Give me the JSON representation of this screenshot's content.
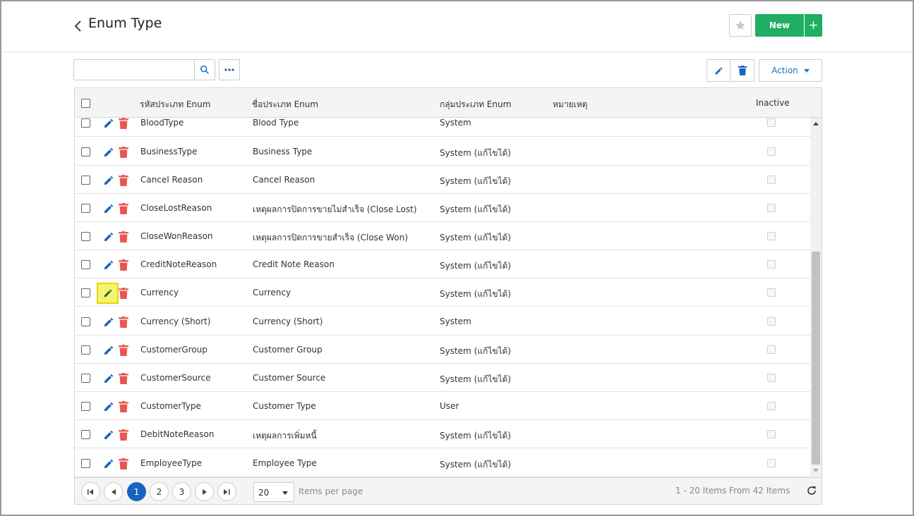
{
  "header": {
    "title": "Enum Type",
    "new_label": "New",
    "plus_label": "+"
  },
  "toolbar": {
    "search_placeholder": "",
    "action_label": "Action"
  },
  "columns": {
    "code": "รหัสประเภท Enum",
    "name": "ชื่อประเภท Enum",
    "group": "กลุ่มประเภท Enum",
    "note": "หมายเหตุ",
    "inactive": "Inactive"
  },
  "rows": [
    {
      "code": "BloodType",
      "name": "Blood Type",
      "group": "System"
    },
    {
      "code": "BusinessType",
      "name": "Business Type",
      "group": "System (แก้ไขได้)"
    },
    {
      "code": "Cancel Reason",
      "name": "Cancel Reason",
      "group": "System (แก้ไขได้)"
    },
    {
      "code": "CloseLostReason",
      "name": "เหตุผลการปิดการขายไม่สำเร็จ (Close Lost)",
      "group": "System (แก้ไขได้)"
    },
    {
      "code": "CloseWonReason",
      "name": "เหตุผลการปิดการขายสำเร็จ (Close Won)",
      "group": "System (แก้ไขได้)"
    },
    {
      "code": "CreditNoteReason",
      "name": "Credit Note Reason",
      "group": "System (แก้ไขได้)"
    },
    {
      "code": "Currency",
      "name": "Currency",
      "group": "System (แก้ไขได้)"
    },
    {
      "code": "Currency (Short)",
      "name": "Currency (Short)",
      "group": "System"
    },
    {
      "code": "CustomerGroup",
      "name": "Customer Group",
      "group": "System (แก้ไขได้)"
    },
    {
      "code": "CustomerSource",
      "name": "Customer Source",
      "group": "System (แก้ไขได้)"
    },
    {
      "code": "CustomerType",
      "name": "Customer Type",
      "group": "User"
    },
    {
      "code": "DebitNoteReason",
      "name": "เหตุผลการเพิ่มหนี้",
      "group": "System (แก้ไขได้)"
    },
    {
      "code": "EmployeeType",
      "name": "Employee Type",
      "group": "System (แก้ไขได้)"
    }
  ],
  "highlighted_row": "Currency",
  "pager": {
    "pages": [
      "1",
      "2",
      "3"
    ],
    "current_page": "1",
    "per_page": "20",
    "items_per_page_label": "Items per page",
    "info": "1 - 20 Items From 42 Items"
  },
  "colors": {
    "primary": "#1565c0",
    "new_button": "#1fae64",
    "delete_icon": "#e8574f",
    "highlight": "#f4f470"
  },
  "icons": {
    "back": "chevron-left-icon",
    "star": "star-icon",
    "search": "search-icon",
    "more": "ellipsis-icon",
    "edit": "pencil-icon",
    "delete": "trash-icon",
    "refresh": "refresh-icon"
  }
}
